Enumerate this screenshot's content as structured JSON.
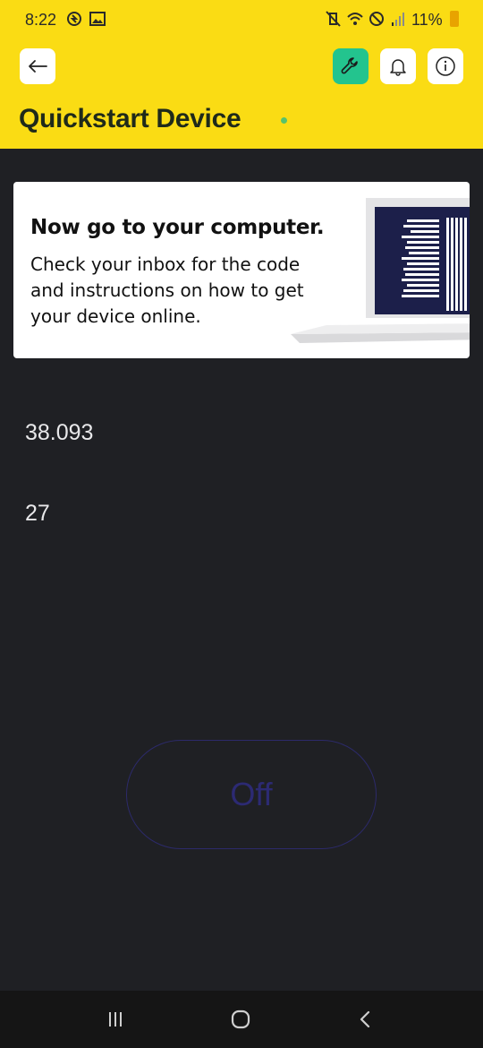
{
  "status_bar": {
    "time": "8:22",
    "battery_text": "11%",
    "icons": [
      "sync-icon",
      "image-icon",
      "mute-vibrate-icon",
      "wifi-icon",
      "do-not-disturb-icon",
      "signal-icon",
      "battery-icon"
    ]
  },
  "header": {
    "title": "Quickstart Device",
    "background_color": "#fadc14",
    "online_dot_color": "#57c26b",
    "buttons": [
      "back-arrow-icon",
      "wrench-icon",
      "bell-icon",
      "info-icon"
    ]
  },
  "card": {
    "heading": "Now go to your computer.",
    "body": "Check your inbox for the code and instructions on how to get your device online."
  },
  "values": {
    "first": "38.093",
    "second": "27"
  },
  "toggle": {
    "label": "Off"
  },
  "nav_bar": {
    "icons": [
      "recents-icon",
      "home-icon",
      "back-icon"
    ]
  }
}
